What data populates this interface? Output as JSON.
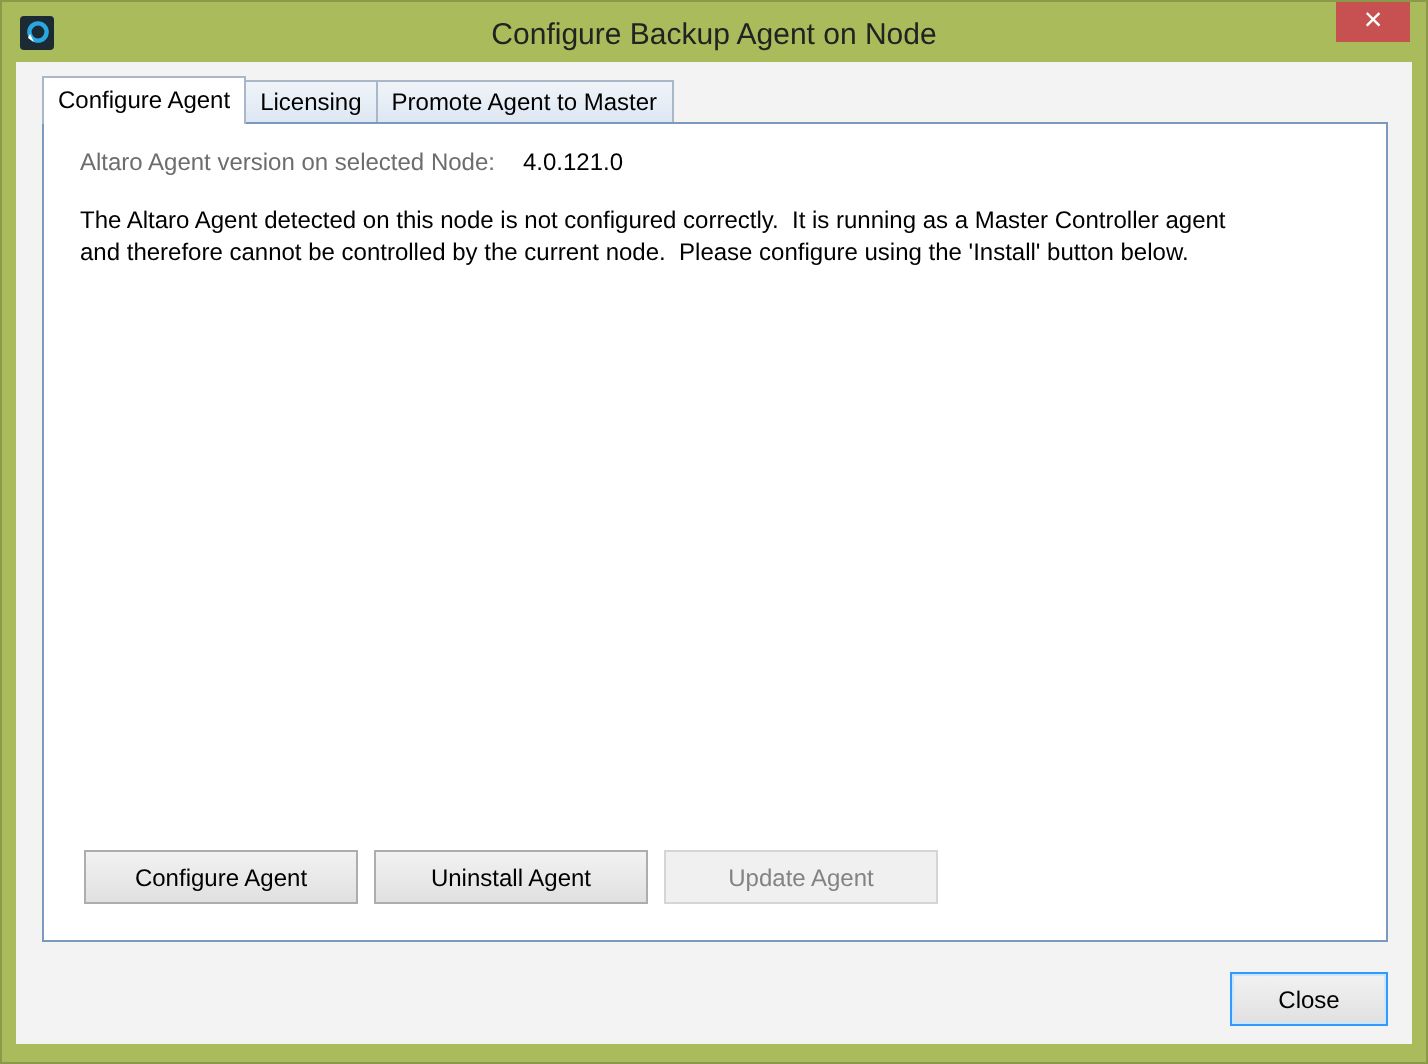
{
  "window": {
    "title": "Configure Backup Agent on Node",
    "close_glyph": "×"
  },
  "tabs": [
    {
      "label": "Configure Agent",
      "selected": true
    },
    {
      "label": "Licensing",
      "selected": false
    },
    {
      "label": "Promote Agent to Master",
      "selected": false
    }
  ],
  "version": {
    "label": "Altaro Agent version on selected Node:",
    "value": "4.0.121.0"
  },
  "message": [
    "The Altaro Agent detected on this node is not configured correctly.  It is running as a Master Controller agent",
    "and therefore cannot be controlled by the current node.  Please configure using the 'Install' button below."
  ],
  "actions": [
    {
      "label": "Configure Agent",
      "disabled": false
    },
    {
      "label": "Uninstall Agent",
      "disabled": false
    },
    {
      "label": "Update Agent",
      "disabled": true
    }
  ],
  "close_button": {
    "label": "Close",
    "focused": true
  }
}
